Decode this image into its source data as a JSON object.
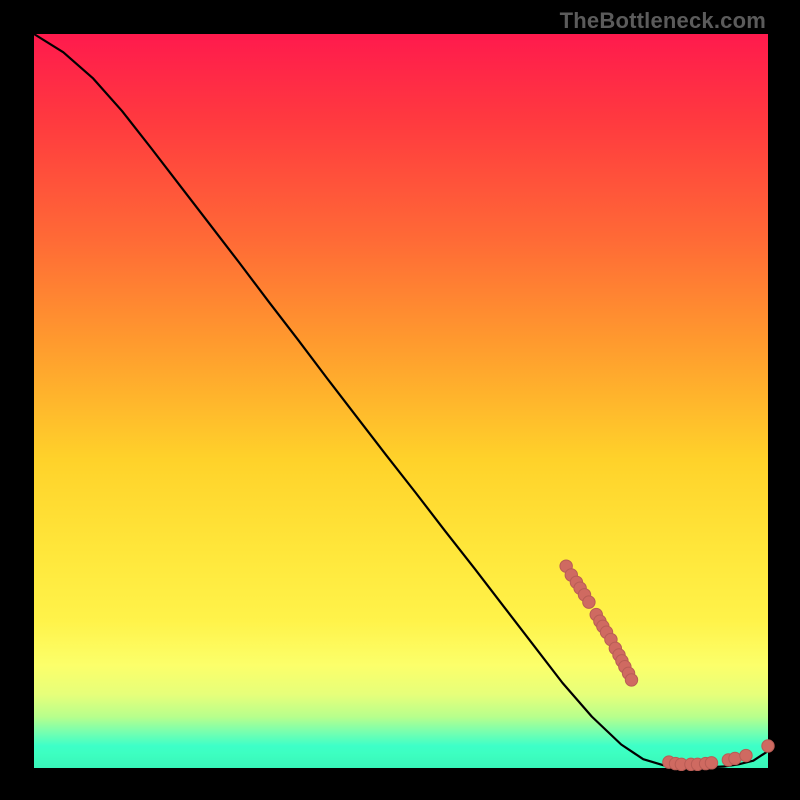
{
  "watermark": "TheBottleneck.com",
  "colors": {
    "background": "#000000",
    "curve": "#000000",
    "marker_fill": "#cf6a61",
    "marker_stroke": "#b85c55"
  },
  "chart_data": {
    "type": "line",
    "title": "",
    "xlabel": "",
    "ylabel": "",
    "xlim": [
      0,
      100
    ],
    "ylim": [
      0,
      100
    ],
    "grid": false,
    "legend": false,
    "series": [
      {
        "name": "curve",
        "x": [
          0,
          4,
          8,
          12,
          16,
          20,
          24,
          28,
          32,
          36,
          40,
          44,
          48,
          52,
          56,
          60,
          64,
          68,
          72,
          76,
          80,
          83,
          86,
          88,
          90,
          92,
          94,
          96,
          98,
          100
        ],
        "y": [
          100,
          97.5,
          94.0,
          89.5,
          84.4,
          79.2,
          74.0,
          68.8,
          63.5,
          58.3,
          53.0,
          47.8,
          42.6,
          37.5,
          32.3,
          27.2,
          22.0,
          16.8,
          11.6,
          7.0,
          3.2,
          1.2,
          0.3,
          0.1,
          0.1,
          0.1,
          0.2,
          0.5,
          1.0,
          2.3
        ]
      }
    ],
    "markers": [
      {
        "x": 72.5,
        "y": 27.5
      },
      {
        "x": 73.2,
        "y": 26.3
      },
      {
        "x": 73.9,
        "y": 25.3
      },
      {
        "x": 74.4,
        "y": 24.5
      },
      {
        "x": 75.0,
        "y": 23.6
      },
      {
        "x": 75.6,
        "y": 22.6
      },
      {
        "x": 76.6,
        "y": 20.9
      },
      {
        "x": 77.1,
        "y": 20.0
      },
      {
        "x": 77.5,
        "y": 19.3
      },
      {
        "x": 78.0,
        "y": 18.5
      },
      {
        "x": 78.6,
        "y": 17.5
      },
      {
        "x": 79.2,
        "y": 16.3
      },
      {
        "x": 79.7,
        "y": 15.4
      },
      {
        "x": 80.1,
        "y": 14.6
      },
      {
        "x": 80.5,
        "y": 13.8
      },
      {
        "x": 81.0,
        "y": 12.9
      },
      {
        "x": 81.4,
        "y": 12.0
      },
      {
        "x": 86.5,
        "y": 0.8
      },
      {
        "x": 87.4,
        "y": 0.6
      },
      {
        "x": 88.2,
        "y": 0.5
      },
      {
        "x": 89.5,
        "y": 0.5
      },
      {
        "x": 90.4,
        "y": 0.5
      },
      {
        "x": 91.5,
        "y": 0.6
      },
      {
        "x": 92.3,
        "y": 0.7
      },
      {
        "x": 94.6,
        "y": 1.1
      },
      {
        "x": 95.5,
        "y": 1.3
      },
      {
        "x": 97.0,
        "y": 1.7
      },
      {
        "x": 100.0,
        "y": 3.0
      }
    ]
  }
}
